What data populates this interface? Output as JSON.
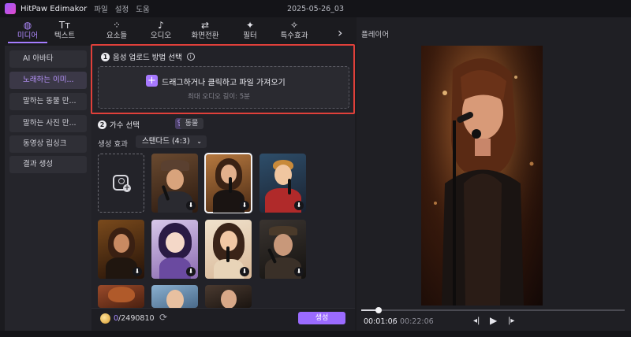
{
  "app": {
    "name": "HitPaw Edimakor",
    "menus": [
      "파일",
      "설정",
      "도움"
    ],
    "document_title": "2025-05-26_03"
  },
  "top_nav": {
    "tabs": [
      {
        "label": "미디어",
        "icon": "media-icon",
        "active": true
      },
      {
        "label": "텍스트",
        "icon": "text-icon",
        "active": false
      },
      {
        "label": "요소들",
        "icon": "elements-icon",
        "active": false
      },
      {
        "label": "오디오",
        "icon": "audio-icon",
        "active": false
      },
      {
        "label": "화면전환",
        "icon": "transition-icon",
        "active": false
      },
      {
        "label": "필터",
        "icon": "filter-icon",
        "active": false
      },
      {
        "label": "특수효과",
        "icon": "effects-icon",
        "active": false
      }
    ],
    "next_icon": "chevron-right-icon"
  },
  "sidebar": {
    "items": [
      {
        "label": "AI 아바타",
        "active": false
      },
      {
        "label": "노래하는 이미...",
        "active": true
      },
      {
        "label": "말하는 동물 만...",
        "active": false
      },
      {
        "label": "말하는 사진 만...",
        "active": false
      },
      {
        "label": "동영상 립싱크",
        "active": false
      },
      {
        "label": "결과 생성",
        "active": false
      }
    ]
  },
  "upload_section": {
    "step_number": "1",
    "title": "음성 업로드 방법 선택",
    "info_icon": "info-icon",
    "dropzone_label": "드래그하거나 클릭하고 파일 가져오기",
    "dropzone_hint": "최대 오디오 길이: 5분",
    "plus_icon": "plus-icon"
  },
  "singer_section": {
    "step_number": "2",
    "title": "가수 선택",
    "chips": [
      {
        "label": "인물",
        "active": true
      },
      {
        "label": "동물",
        "active": false
      }
    ],
    "effect_label": "생성 효과",
    "effect_value": "스탠다드 (4:3)",
    "avatars": [
      {
        "name": "boy-with-hat",
        "selected": false
      },
      {
        "name": "woman-singing",
        "selected": true
      },
      {
        "name": "boy-red-shirt",
        "selected": false
      },
      {
        "name": "woman-stage",
        "selected": false
      },
      {
        "name": "anime-girl",
        "selected": false
      },
      {
        "name": "cartoon-girl",
        "selected": false
      },
      {
        "name": "bearded-man-hat",
        "selected": false
      },
      {
        "name": "curly-hair",
        "selected": false
      },
      {
        "name": "boy-blue",
        "selected": false
      },
      {
        "name": "young-man",
        "selected": false
      }
    ]
  },
  "bottom_bar": {
    "credits_used": "0",
    "credits_total": "/2490810",
    "generate_label": "생성"
  },
  "player": {
    "title": "플레이어",
    "current_time": "00:01:06",
    "separator": "/",
    "total_time": "00:22:06",
    "progress": 0.05
  }
}
